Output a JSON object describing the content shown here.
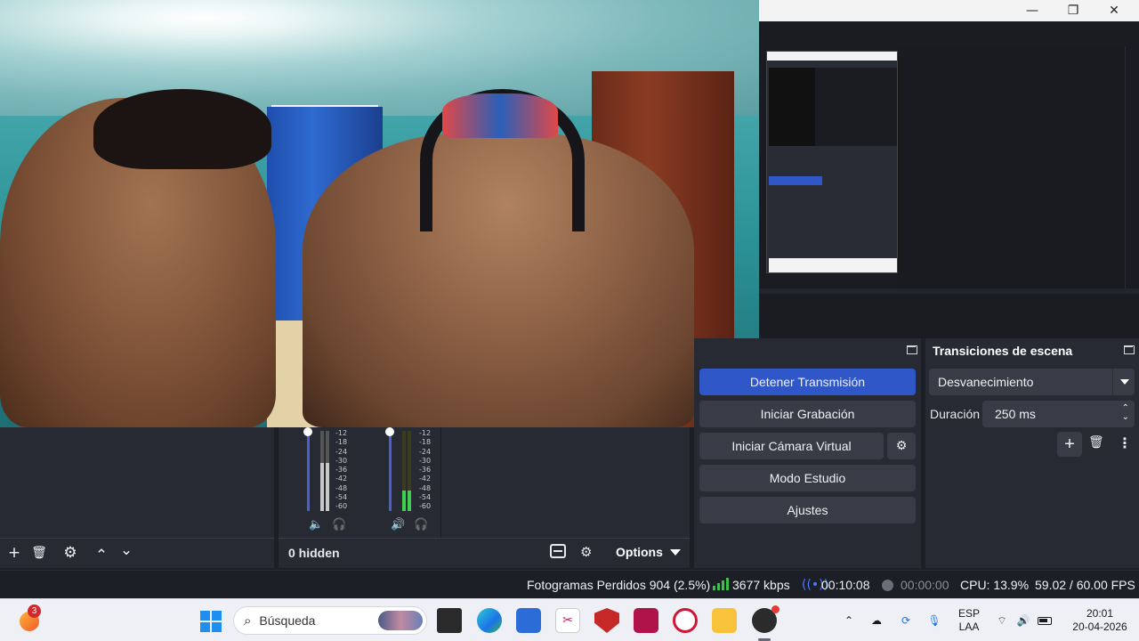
{
  "window": {
    "minimize": "—",
    "maximize": "❐",
    "close": "✕"
  },
  "sources_toolbar": {
    "add": "+",
    "remove": "🗑",
    "settings": "⚙",
    "up": "⌃",
    "down": "⌄"
  },
  "mixer": {
    "scale": [
      "-12",
      "-18",
      "-24",
      "-30",
      "-36",
      "-42",
      "-48",
      "-54",
      "-60"
    ],
    "channel1": {
      "muted": true,
      "level": 0.6
    },
    "channel2": {
      "muted": false,
      "level": 0.25
    },
    "hidden_label": "0 hidden",
    "options_label": "Options"
  },
  "controls": {
    "stop_stream": "Detener Transmisión",
    "start_recording": "Iniciar Grabación",
    "start_virtual_cam": "Iniciar Cámara Virtual",
    "studio_mode": "Modo Estudio",
    "settings": "Ajustes"
  },
  "transitions": {
    "header": "Transiciones de escena",
    "selected": "Desvanecimiento",
    "duration_label": "Duración",
    "duration_value": "250 ms"
  },
  "status": {
    "dropped_frames": "Fotogramas Perdidos 904 (2.5%)",
    "bitrate": "3677 kbps",
    "stream_time": "00:10:08",
    "rec_time": "00:00:00",
    "cpu": "CPU: 13.9%",
    "fps": "59.02 / 60.00 FPS"
  },
  "taskbar": {
    "search_placeholder": "Búsqueda",
    "badge_count": "3",
    "language": "ESP",
    "layout": "LAA",
    "time": "20:01",
    "date": "20-04-2026"
  },
  "colors": {
    "accent": "#2f57c8",
    "live_green": "#39c24a",
    "dock_bg": "#272a33"
  }
}
